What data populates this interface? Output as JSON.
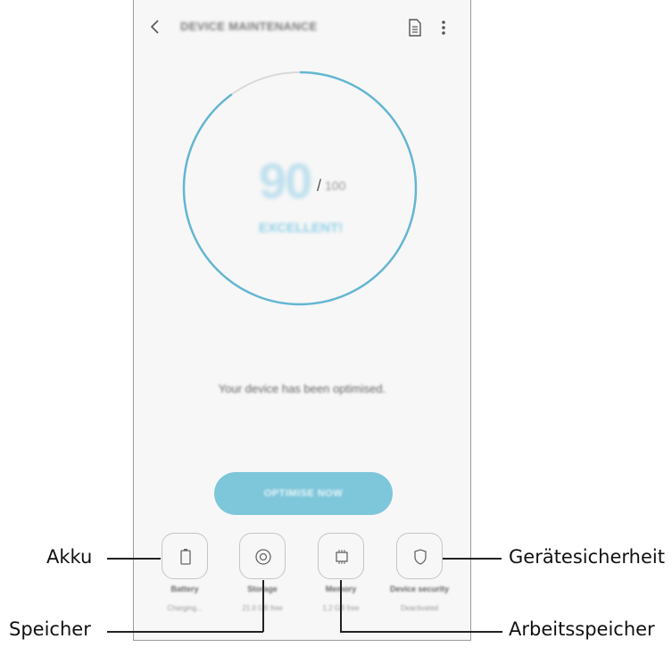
{
  "app_bar": {
    "title": "DEVICE MAINTENANCE"
  },
  "score": {
    "value": "90",
    "slash": "/",
    "max": "100",
    "status": "EXCELLENT!",
    "progress_fraction": 0.9
  },
  "message": "Your device has been optimised.",
  "optimise_button": "OPTIMISE NOW",
  "tiles": [
    {
      "label": "Battery",
      "sub": "Charging...",
      "icon": "battery-icon"
    },
    {
      "label": "Storage",
      "sub": "21.0 GB free",
      "icon": "storage-icon"
    },
    {
      "label": "Memory",
      "sub": "1.2 GB free",
      "icon": "memory-chip-icon"
    },
    {
      "label": "Device security",
      "sub": "Deactivated",
      "icon": "shield-icon"
    }
  ],
  "callouts": {
    "akku": "Akku",
    "speicher": "Speicher",
    "arbeitsspeicher": "Arbeitsspeicher",
    "geraetesicherheit": "Gerätesicherheit"
  },
  "colors": {
    "ring": "#63b6d2",
    "ring_track": "#d9d9d9",
    "button": "#7ec6da"
  }
}
